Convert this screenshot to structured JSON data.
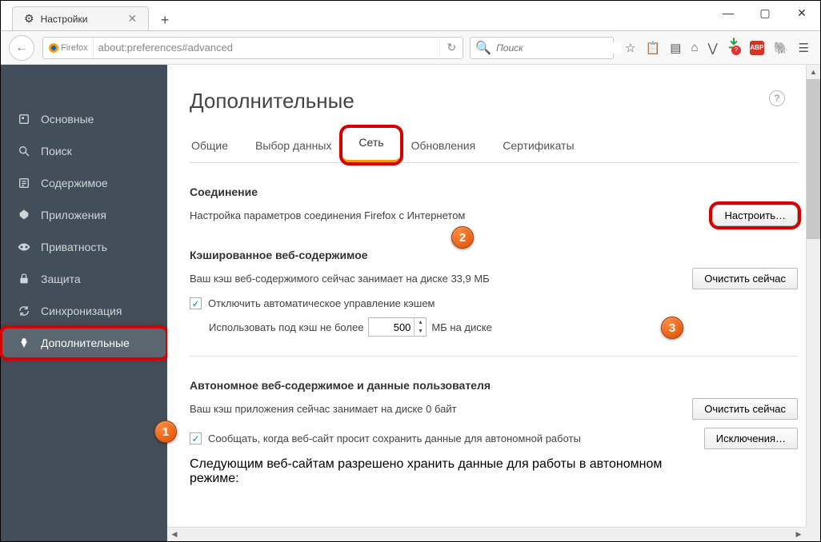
{
  "window": {
    "tab_title": "Настройки"
  },
  "urlbar": {
    "brand": "Firefox",
    "value": "about:preferences#advanced"
  },
  "searchbar": {
    "placeholder": "Поиск"
  },
  "download_badge": "?",
  "abp_label": "ABP",
  "sidebar": {
    "items": [
      {
        "label": "Основные"
      },
      {
        "label": "Поиск"
      },
      {
        "label": "Содержимое"
      },
      {
        "label": "Приложения"
      },
      {
        "label": "Приватность"
      },
      {
        "label": "Защита"
      },
      {
        "label": "Синхронизация"
      },
      {
        "label": "Дополнительные"
      }
    ]
  },
  "page": {
    "title": "Дополнительные",
    "tabs": [
      "Общие",
      "Выбор данных",
      "Сеть",
      "Обновления",
      "Сертификаты"
    ],
    "connection": {
      "heading": "Соединение",
      "desc": "Настройка параметров соединения Firefox с Интернетом",
      "configure_btn": "Настроить…"
    },
    "cached": {
      "heading": "Кэшированное веб-содержимое",
      "usage": "Ваш кэш веб-содержимого сейчас занимает на диске 33,9 МБ",
      "clear_btn": "Очистить сейчас",
      "override_label": "Отключить автоматическое управление кэшем",
      "limit_prefix": "Использовать под кэш не более",
      "limit_value": "500",
      "limit_suffix": "МБ на диске"
    },
    "offline": {
      "heading": "Автономное веб-содержимое и данные пользователя",
      "usage": "Ваш кэш приложения сейчас занимает на диске 0 байт",
      "clear_btn": "Очистить сейчас",
      "notify_label": "Сообщать, когда веб-сайт просит сохранить данные для автономной работы",
      "exceptions_btn": "Исключения…",
      "allowed_prefix": "Следующим веб-сайтам разрешено хранить данные для работы в автономном режиме:"
    }
  },
  "badges": {
    "b1": "1",
    "b2": "2",
    "b3": "3"
  }
}
